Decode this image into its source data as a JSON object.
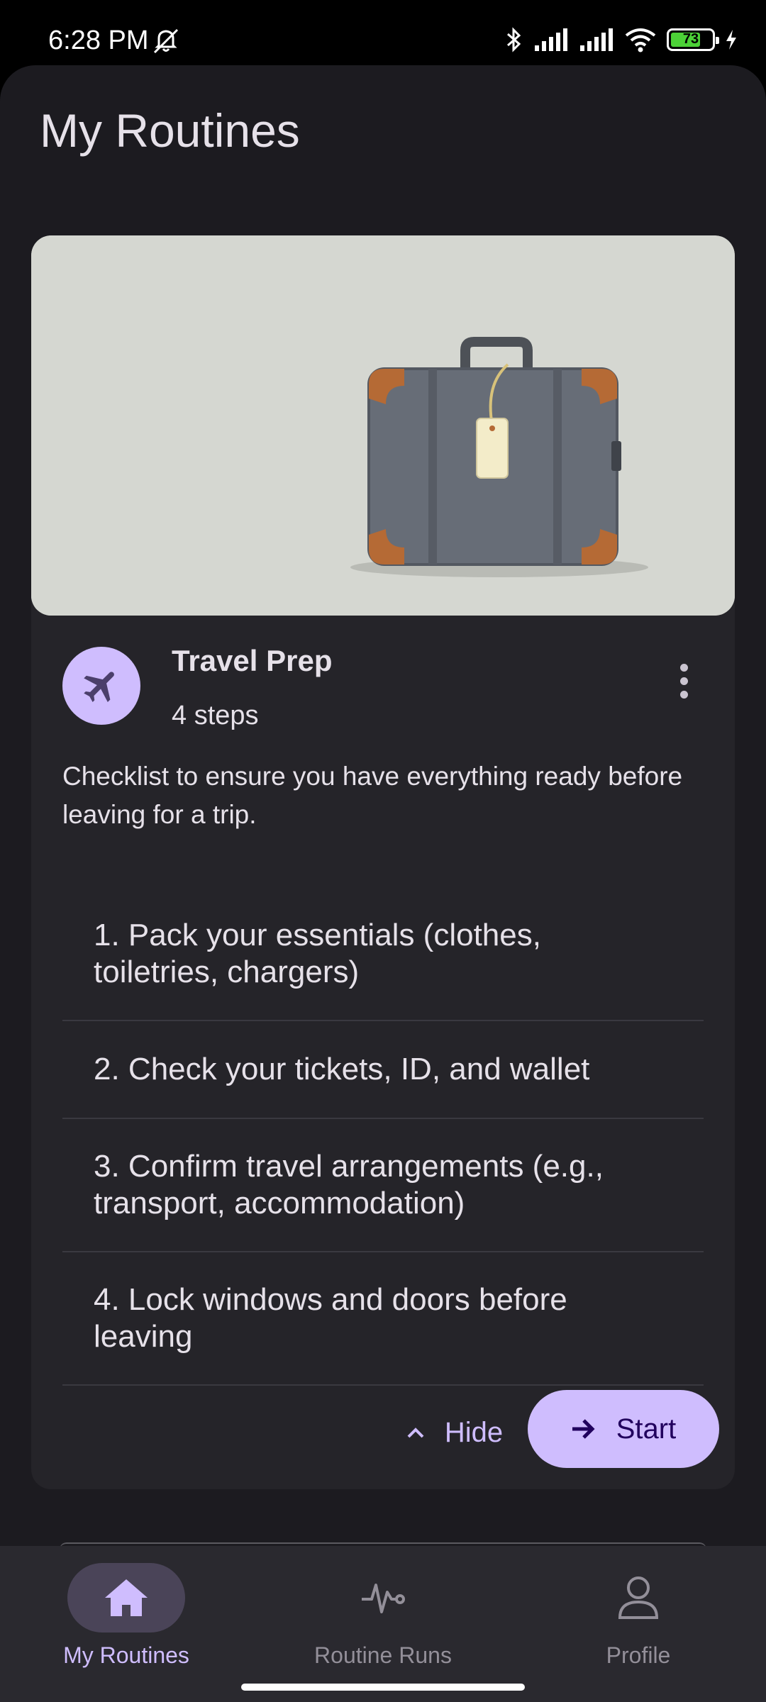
{
  "status_bar": {
    "time": "6:28 PM",
    "battery_level": "73",
    "battery_fraction": 0.73,
    "icons": [
      "mute-icon",
      "bluetooth-icon",
      "signal-icon",
      "signal-icon",
      "wifi-icon",
      "battery-icon",
      "charging-icon"
    ]
  },
  "header": {
    "title": "My Routines"
  },
  "routine": {
    "title": "Travel Prep",
    "step_count": "4 steps",
    "description": "Checklist to ensure you have everything ready before leaving for a trip.",
    "icon": "airplane-icon",
    "steps": [
      "1. Pack your essentials (clothes, toiletries, chargers)",
      "2. Check your tickets, ID, and wallet",
      "3. Confirm travel arrangements (e.g., transport, accommodation)",
      "4. Lock windows and doors before leaving"
    ],
    "hide_label": "Hide",
    "start_label": "Start"
  },
  "bottom_nav": {
    "items": [
      {
        "label": "My Routines",
        "icon": "home-icon",
        "active": true
      },
      {
        "label": "Routine Runs",
        "icon": "activity-icon",
        "active": false
      },
      {
        "label": "Profile",
        "icon": "person-icon",
        "active": false
      }
    ]
  },
  "colors": {
    "background": "#1c1b20",
    "card": "#252429",
    "accent": "#cfbdfe",
    "on_accent": "#21005d",
    "nav_bar": "#2a292f",
    "battery_green": "#4cd137"
  }
}
